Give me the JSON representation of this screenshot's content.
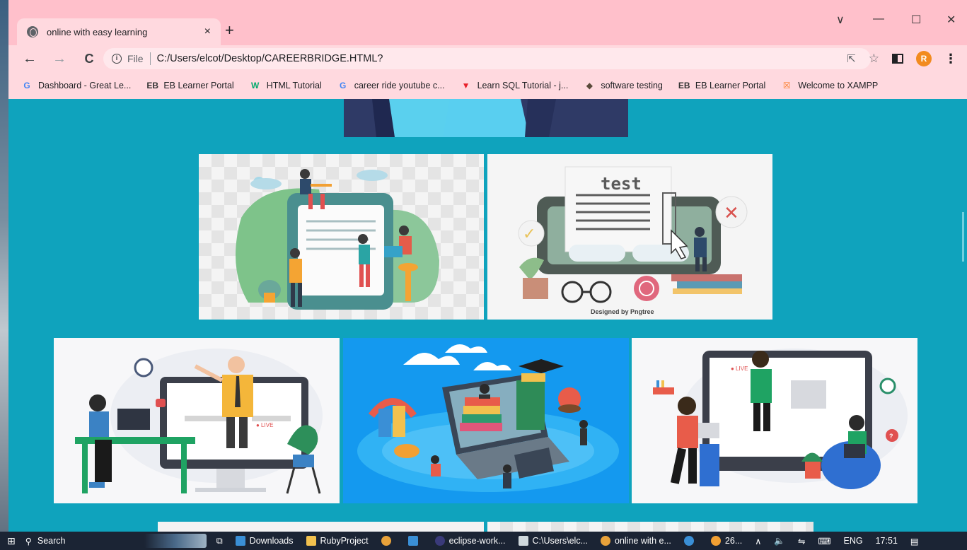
{
  "browser": {
    "tab_title": "online with easy learning",
    "tab_close": "×",
    "new_tab": "+",
    "file_label": "File",
    "url": "C:/Users/elcot/Desktop/CAREERBRIDGE.HTML?",
    "avatar_letter": "R",
    "window_controls": [
      "∨",
      "—",
      "☐",
      "✕"
    ]
  },
  "bookmarks": [
    {
      "icon": "G",
      "label": "Dashboard - Great Le...",
      "color": "#4285f4"
    },
    {
      "icon": "EB",
      "label": "EB Learner Portal",
      "color": "#333333"
    },
    {
      "icon": "W",
      "label": "HTML Tutorial",
      "color": "#04aa6d"
    },
    {
      "icon": "G",
      "label": "career ride youtube c...",
      "color": "#4285f4"
    },
    {
      "icon": "▼",
      "label": "Learn SQL Tutorial - j...",
      "color": "#e8212b"
    },
    {
      "icon": "◆",
      "label": "software testing",
      "color": "#5a4a3a"
    },
    {
      "icon": "EB",
      "label": "EB Learner Portal",
      "color": "#333333"
    },
    {
      "icon": "☒",
      "label": "Welcome to XAMPP",
      "color": "#fb7a24"
    }
  ],
  "page": {
    "test_card_text": "test",
    "designed_by": "Designed by Pngtree",
    "live_badge": "● LIVE"
  },
  "taskbar": {
    "search": "Search",
    "items": [
      "Downloads",
      "RubyProject",
      "eclipse-work...",
      "C:\\Users\\elc...",
      "online with e..."
    ],
    "weather": "26...",
    "lang": "ENG",
    "time": "17:51"
  }
}
